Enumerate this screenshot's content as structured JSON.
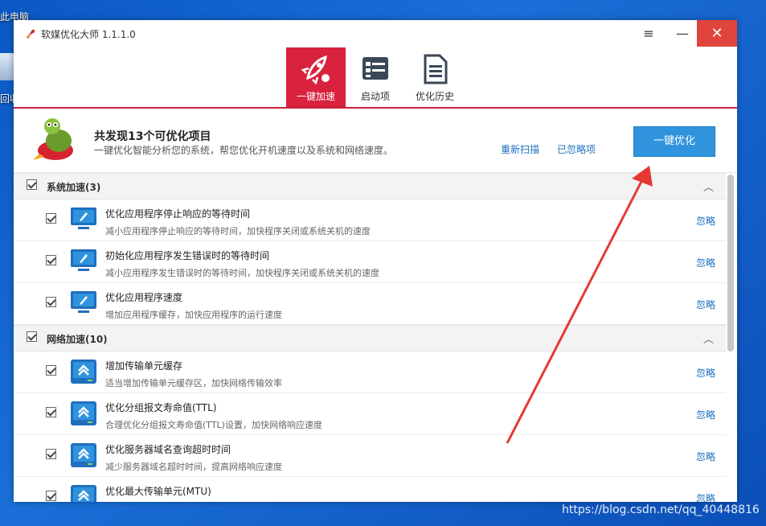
{
  "desktop": {
    "icons": [
      {
        "label": "此电脑"
      },
      {
        "label": "回收"
      }
    ]
  },
  "window": {
    "title": "软媒优化大师 1.1.1.0",
    "controls": {
      "menu": "≡",
      "minimize": "—",
      "close": "✕"
    }
  },
  "tabs": [
    {
      "label": "一键加速",
      "active": true
    },
    {
      "label": "启动项",
      "active": false
    },
    {
      "label": "优化历史",
      "active": false
    }
  ],
  "summary": {
    "title": "共发现13个可优化项目",
    "description": "一键优化智能分析您的系统，帮您优化开机速度以及系统和网络速度。",
    "rescan_link": "重新扫描",
    "ignored_link": "已忽略项",
    "optimize_button": "一键优化"
  },
  "groups": [
    {
      "title": "系统加速(3)",
      "items": [
        {
          "title": "优化应用程序停止响应的等待时间",
          "desc": "减小应用程序停止响应的等待时间，加快程序关闭或系统关机的速度",
          "ignore": "忽略"
        },
        {
          "title": "初始化应用程序发生错误时的等待时间",
          "desc": "减小应用程序发生错误时的等待时间，加快程序关闭或系统关机的速度",
          "ignore": "忽略"
        },
        {
          "title": "优化应用程序速度",
          "desc": "增加应用程序缓存，加快应用程序的运行速度",
          "ignore": "忽略"
        }
      ]
    },
    {
      "title": "网络加速(10)",
      "items": [
        {
          "title": "增加传输单元缓存",
          "desc": "适当增加传输单元缓存区，加快网络传输效率",
          "ignore": "忽略"
        },
        {
          "title": "优化分组报文寿命值(TTL)",
          "desc": "合理优化分组报文寿命值(TTL)设置，加快网络响应速度",
          "ignore": "忽略"
        },
        {
          "title": "优化服务器域名查询超时时间",
          "desc": "减少服务器域名超时时间，提高网络响应速度",
          "ignore": "忽略"
        },
        {
          "title": "优化最大传输单元(MTU)",
          "desc": "",
          "ignore": "忽略"
        }
      ]
    }
  ],
  "watermark": "https://blog.csdn.net/qq_40448816",
  "colors": {
    "accent": "#d8223e",
    "button": "#2f93dd",
    "link": "#1a6fbf",
    "arrow": "#e53935"
  }
}
